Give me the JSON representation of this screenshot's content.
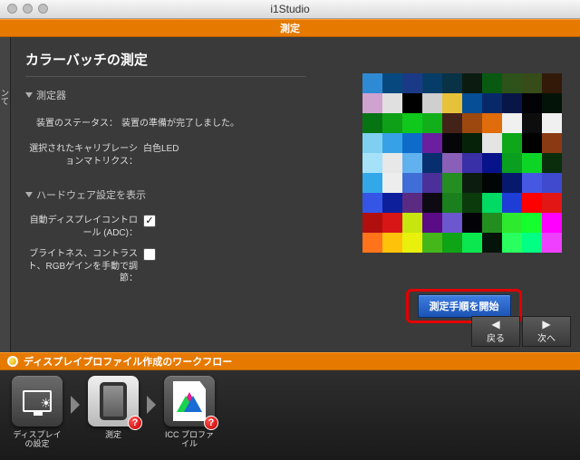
{
  "window": {
    "title": "i1Studio"
  },
  "tab_active": "測定",
  "page": {
    "title": "カラーバッチの測定",
    "device": {
      "header": "測定器",
      "status_label": "装置のステータス：",
      "status_value": "装置の準備が完了しました。"
    },
    "matrix": {
      "label": "選択されたキャリブレーションマトリクス：",
      "value": "白色LED"
    },
    "hw": {
      "header": "ハードウェア設定を表示",
      "adc_label": "自動ディスプレイコントロール (ADC)：",
      "adc_checked": true,
      "manual_label": "ブライトネス、コントラスト、RGBゲインを手動で調節：",
      "manual_checked": false
    },
    "start_button": "測定手順を開始",
    "nav": {
      "back": "戻る",
      "next": "次へ"
    }
  },
  "left_sliver": "ンて",
  "workflow": {
    "title": "ディスプレイプロファイル作成のワークフロー",
    "steps": [
      {
        "key": "display-settings",
        "label": "ディスプレイの設定",
        "badge": ""
      },
      {
        "key": "measure",
        "label": "測定",
        "badge": "?"
      },
      {
        "key": "icc-profile",
        "label": "ICC プロファイル",
        "badge": "?"
      }
    ]
  },
  "patch_colors": [
    "#2f8ad6",
    "#07487f",
    "#1a3a88",
    "#063d68",
    "#083246",
    "#0c1b10",
    "#095913",
    "#2d521a",
    "#364c19",
    "#321908",
    "#d0a2cf",
    "#e0e0e0",
    "#000000",
    "#cfcfcf",
    "#e6c23a",
    "#064e95",
    "#07296a",
    "#071647",
    "#020207",
    "#031307",
    "#077413",
    "#0ea118",
    "#0fc81b",
    "#11b01a",
    "#43221a",
    "#9c480e",
    "#e06c0b",
    "#f0f0f0",
    "#0d0d0d",
    "#f0f0f0",
    "#7ecff2",
    "#37a1e7",
    "#0e6bc9",
    "#6a1fa0",
    "#050607",
    "#06230a",
    "#e4e4e4",
    "#0da719",
    "#000000",
    "#8a3a13",
    "#a5e2fa",
    "#e8e8e8",
    "#61b1ee",
    "#072f6f",
    "#8a5fb8",
    "#392fa7",
    "#07138a",
    "#08a01e",
    "#0dd526",
    "#0a2e0c",
    "#33a8e8",
    "#ededed",
    "#3f6ed6",
    "#4b309a",
    "#258e22",
    "#0c1d10",
    "#020505",
    "#07196d",
    "#4657e3",
    "#3f4acf",
    "#3555e6",
    "#0d1f9b",
    "#5b2a82",
    "#0e0a14",
    "#1b7f1d",
    "#0b3a0c",
    "#01da63",
    "#1d3dd6",
    "#ff0000",
    "#e31616",
    "#b10e0e",
    "#d91616",
    "#c7e50e",
    "#5a0b86",
    "#6c57ce",
    "#030307",
    "#248d20",
    "#2eea2f",
    "#15ff2e",
    "#ff00ff",
    "#ff741b",
    "#ffc20a",
    "#e8f00c",
    "#45b71a",
    "#0fa316",
    "#0be74e",
    "#05140b",
    "#29ff5e",
    "#00ff82",
    "#f040ff"
  ]
}
